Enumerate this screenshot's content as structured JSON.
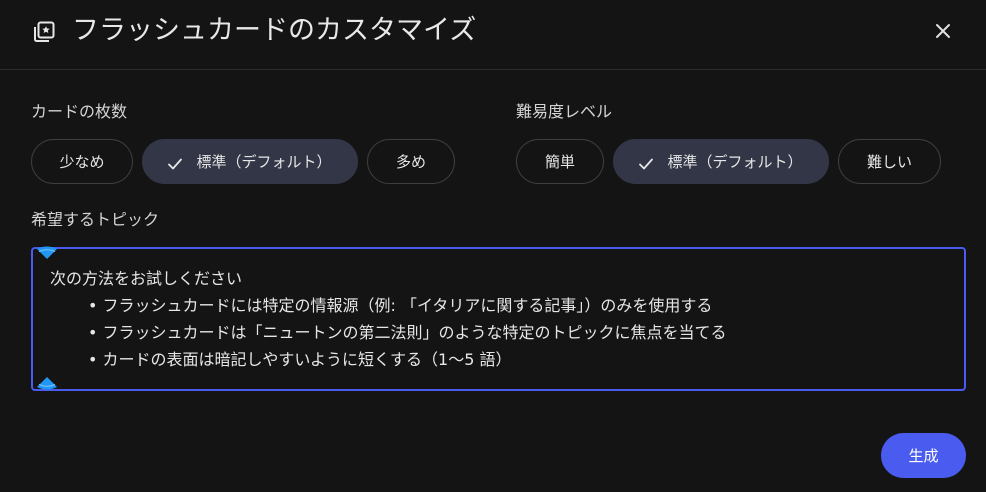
{
  "dialog": {
    "title": "フラッシュカードのカスタマイズ",
    "header_icon": "flashcard-stack-icon",
    "close_icon": "close-icon"
  },
  "card_count": {
    "label": "カードの枚数",
    "options": [
      "少なめ",
      "標準（デフォルト）",
      "多め"
    ],
    "selected": "標準（デフォルト）"
  },
  "difficulty": {
    "label": "難易度レベル",
    "options": [
      "簡単",
      "標準（デフォルト）",
      "難しい"
    ],
    "selected": "標準（デフォルト）"
  },
  "topic": {
    "label": "希望するトピック",
    "intro": "次の方法をお試しください",
    "bullets": [
      "• フラッシュカードには特定の情報源（例: 「イタリアに関する記事」）のみを使用する",
      "• フラッシュカードは「ニュートンの第二法則」のような特定のトピックに焦点を当てる",
      "• カードの表面は暗記しやすいように短くする（1〜5 語）"
    ]
  },
  "actions": {
    "generate_label": "生成"
  },
  "colors": {
    "background": "#141414",
    "accent": "#4a5cf0",
    "selected_chip": "#333647",
    "handle": "#2196f3"
  }
}
